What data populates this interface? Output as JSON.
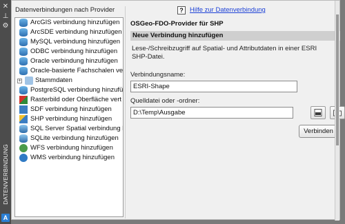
{
  "palette": {
    "vertical_title": "DATENVERBINDUNG",
    "logo_letter": "A",
    "strip_buttons": [
      "✕",
      "⊥",
      "⚙"
    ]
  },
  "left_panel": {
    "header": "Datenverbindungen nach Provider",
    "items": [
      {
        "label": "ArcGIS verbindung hinzufügen",
        "icon": "database-icon"
      },
      {
        "label": "ArcSDE verbindung hinzufügen",
        "icon": "database-icon"
      },
      {
        "label": "MySQL verbindung hinzufügen",
        "icon": "database-icon"
      },
      {
        "label": "ODBC verbindung hinzufügen",
        "icon": "database-icon"
      },
      {
        "label": "Oracle verbindung hinzufügen",
        "icon": "database-icon"
      },
      {
        "label": "Oracle-basierte Fachschalen ver",
        "icon": "database-icon"
      },
      {
        "label": "Stammdaten",
        "icon": "folder-icon",
        "child": true
      },
      {
        "label": "PostgreSQL verbindung hinzufü",
        "icon": "database-icon"
      },
      {
        "label": "Rasterbild oder Oberfläche vert",
        "icon": "raster-icon"
      },
      {
        "label": "SDF verbindung hinzufügen",
        "icon": "sdf-icon"
      },
      {
        "label": "SHP verbindung hinzufügen",
        "icon": "shp-icon"
      },
      {
        "label": "SQL Server Spatial verbindung l",
        "icon": "sqlserver-icon"
      },
      {
        "label": "SQLite verbindung hinzufügen",
        "icon": "sqlite-icon"
      },
      {
        "label": "WFS verbindung hinzufügen",
        "icon": "wfs-icon"
      },
      {
        "label": "WMS verbindung hinzufügen",
        "icon": "wms-icon"
      }
    ]
  },
  "right_panel": {
    "help_icon": "?",
    "help_link": "Hilfe zur Datenverbindung",
    "provider_title": "OSGeo-FDO-Provider für SHP",
    "section_title": "Neue Verbindung hinzufügen",
    "description": "Lese-/Schreibzugriff auf Spatial- und Attributdaten in einer ESRI SHP-Datei.",
    "connection_name_label": "Verbindungsname:",
    "connection_name_value": "ESRI-Shape",
    "source_label": "Quelldatei oder -ordner:",
    "source_value": "D:\\Temp\\Ausgabe",
    "connect_button": "Verbinden"
  }
}
